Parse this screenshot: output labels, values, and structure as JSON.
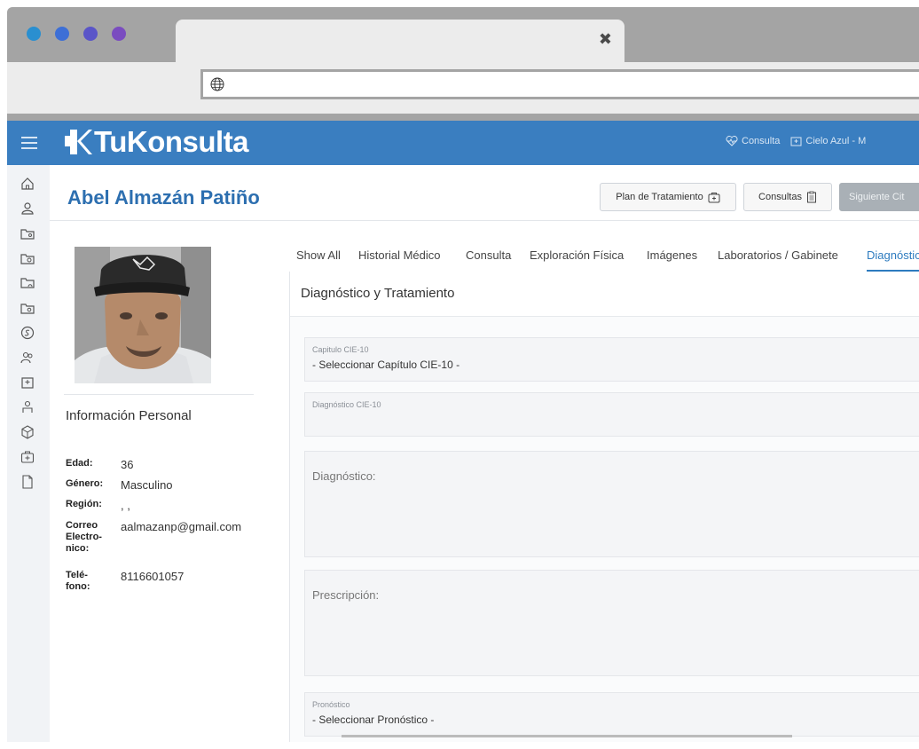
{
  "browser": {
    "dot_colors": [
      "#2a8fd0",
      "#3d6fd6",
      "#5a55c8",
      "#7a4cc0"
    ],
    "tab_close": "✖"
  },
  "app": {
    "brand": "TuKonsulta",
    "brand_color": "#3a7ec0",
    "topnav": {
      "consulta": "Consulta",
      "clinic": "Cielo Azul - M"
    }
  },
  "patient": {
    "name": "Abel Almazán Patiño"
  },
  "header_buttons": {
    "plan": "Plan de Tratamiento",
    "consultas": "Consultas",
    "siguiente": "Siguiente Cit"
  },
  "personal_info": {
    "title": "Información Personal",
    "rows": [
      {
        "key": "Edad:",
        "value": "36"
      },
      {
        "key": "Género:",
        "value": "Masculino"
      },
      {
        "key": "Región:",
        "value": ", ,"
      },
      {
        "key": "Correo Electro-nico:",
        "value": "aalmazanp@gmail.com"
      },
      {
        "key": "Telé-fono:",
        "value": "8116601057"
      }
    ]
  },
  "tabs": [
    {
      "label": "Show All",
      "active": false
    },
    {
      "label": "Historial Médico",
      "active": false
    },
    {
      "label": "Consulta",
      "active": false
    },
    {
      "label": "Exploración Física",
      "active": false
    },
    {
      "label": "Imágenes",
      "active": false
    },
    {
      "label": "Laboratorios / Gabinete",
      "active": false
    },
    {
      "label": "Diagnóstic",
      "active": true
    }
  ],
  "section": {
    "title": "Diagnóstico y Tratamiento",
    "capitulo": {
      "label": "Capitulo CIE-10",
      "value": "- Seleccionar Capítulo CIE-10 -"
    },
    "diagnostico_cie": {
      "label": "Diagnóstico CIE-10",
      "value": ""
    },
    "diagnostico": {
      "placeholder": "Diagnóstico:"
    },
    "prescripcion": {
      "placeholder": "Prescripción:"
    },
    "pronostico": {
      "label": "Pronóstico",
      "value": "- Seleccionar Pronóstico -"
    }
  }
}
